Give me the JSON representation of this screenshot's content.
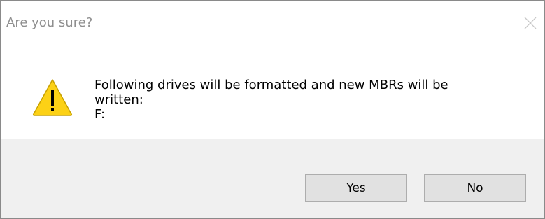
{
  "dialog": {
    "title": "Are you sure?",
    "close_icon": "close-icon",
    "icon": "warning-icon",
    "message_lines": [
      "Following drives will be formatted and new MBRs will be",
      "written:",
      "F:"
    ],
    "buttons": {
      "yes_label": "Yes",
      "no_label": "No"
    }
  },
  "colors": {
    "title_text": "#8f8f8f",
    "footer_bg": "#f0f0f0",
    "button_bg": "#e1e1e1",
    "button_border": "#adadad",
    "warning_fill": "#fcd116",
    "warning_stroke": "#c7a000"
  }
}
